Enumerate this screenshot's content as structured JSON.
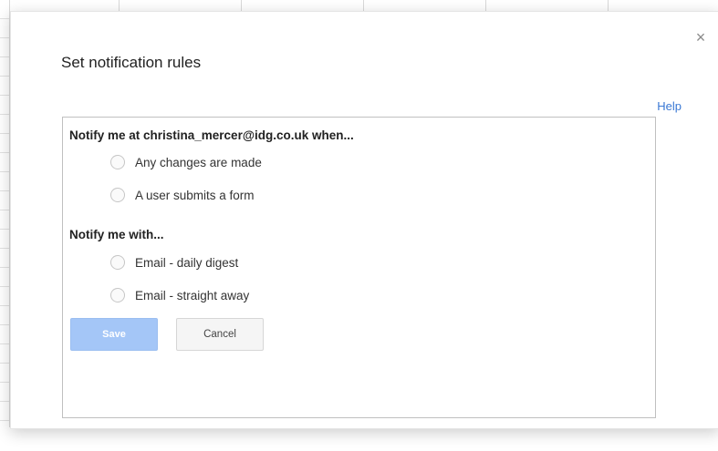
{
  "dialog": {
    "title": "Set notification rules",
    "close_symbol": "×",
    "help_label": "Help"
  },
  "rules": {
    "when_heading": "Notify me at christina_mercer@idg.co.uk when...",
    "when_options": [
      {
        "label": "Any changes are made",
        "selected": false
      },
      {
        "label": "A user submits a form",
        "selected": false
      }
    ],
    "with_heading": "Notify me with...",
    "with_options": [
      {
        "label": "Email - daily digest",
        "selected": false
      },
      {
        "label": "Email - straight away",
        "selected": false
      }
    ]
  },
  "buttons": {
    "save_label": "Save",
    "cancel_label": "Cancel"
  },
  "colors": {
    "link": "#3a78d4",
    "save_disabled_bg": "#a4c6f7"
  },
  "icons": {
    "close": "close-icon"
  }
}
